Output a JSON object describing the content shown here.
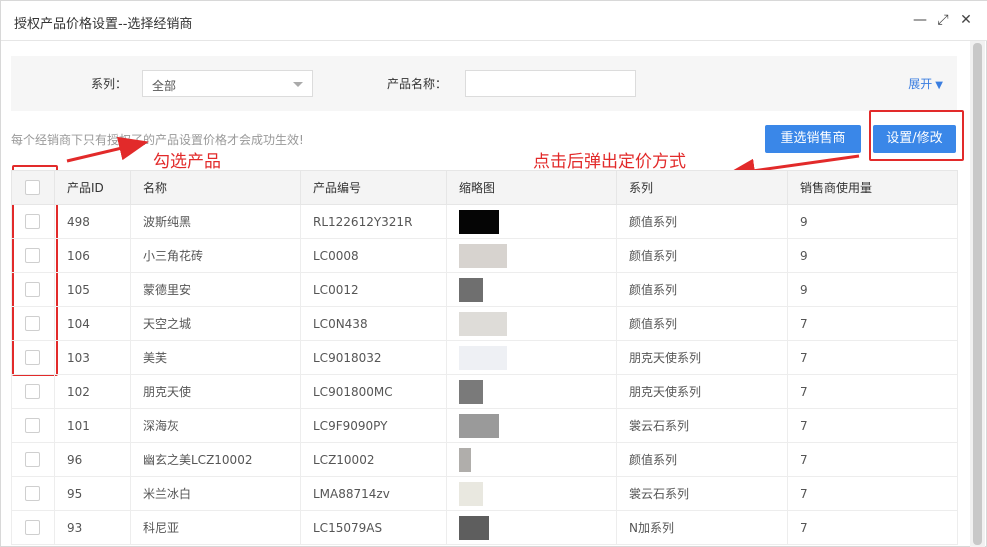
{
  "window": {
    "title": "授权产品价格设置--选择经销商",
    "minimize_label": "—",
    "maximize_label": "⤢",
    "close_label": "✕"
  },
  "filter": {
    "series_label": "系列：",
    "series_value": "全部",
    "product_name_label": "产品名称：",
    "product_name_value": "",
    "expand_label": "展开",
    "expand_icon": "▼"
  },
  "notice": "每个经销商下只有授权了的产品设置价格才会成功生效!",
  "buttons": {
    "reselect": "重选销售商",
    "set_modify": "设置/修改"
  },
  "annotations": {
    "check_products": "勾选产品",
    "click_popup": "点击后弹出定价方式"
  },
  "table": {
    "columns": [
      "产品ID",
      "名称",
      "产品编号",
      "缩略图",
      "系列",
      "销售商使用量"
    ],
    "rows": [
      {
        "id": "498",
        "name": "波斯纯黑",
        "code": "RL122612Y321R",
        "series": "颜值系列",
        "usage": "9",
        "thumb": "#050505",
        "thumb_w": "1"
      },
      {
        "id": "106",
        "name": "小三角花砖",
        "code": "LC0008",
        "series": "颜值系列",
        "usage": "9",
        "thumb": "#d7d3cf",
        "thumb_w": "1.2"
      },
      {
        "id": "105",
        "name": "蒙德里安",
        "code": "LC0012",
        "series": "颜值系列",
        "usage": "9",
        "thumb": "#6f6f6f",
        "thumb_w": "0.6"
      },
      {
        "id": "104",
        "name": "天空之城",
        "code": "LC0N438",
        "series": "颜值系列",
        "usage": "7",
        "thumb": "#dedcd8",
        "thumb_w": "1.2"
      },
      {
        "id": "103",
        "name": "美芙",
        "code": "LC9018032",
        "series": "朋克天使系列",
        "usage": "7",
        "thumb": "#eef0f4",
        "thumb_w": "1.2"
      },
      {
        "id": "102",
        "name": "朋克天使",
        "code": "LC901800MC",
        "series": "朋克天使系列",
        "usage": "7",
        "thumb": "#7a7a7a",
        "thumb_w": "0.6"
      },
      {
        "id": "101",
        "name": "深海灰",
        "code": "LC9F9090PY",
        "series": "裳云石系列",
        "usage": "7",
        "thumb": "#9a9a9a",
        "thumb_w": "1"
      },
      {
        "id": "96",
        "name": "幽玄之美LCZ10002",
        "code": "LCZ10002",
        "series": "颜值系列",
        "usage": "7",
        "thumb": "#b0aeab",
        "thumb_w": "0.3"
      },
      {
        "id": "95",
        "name": "米兰冰白",
        "code": "LMA88714zv",
        "series": "裳云石系列",
        "usage": "7",
        "thumb": "#e9e8e0",
        "thumb_w": "0.6"
      },
      {
        "id": "93",
        "name": "科尼亚",
        "code": "LC15079AS",
        "series": "N加系列",
        "usage": "7",
        "thumb": "#5e5e5e",
        "thumb_w": "0.75"
      }
    ]
  }
}
